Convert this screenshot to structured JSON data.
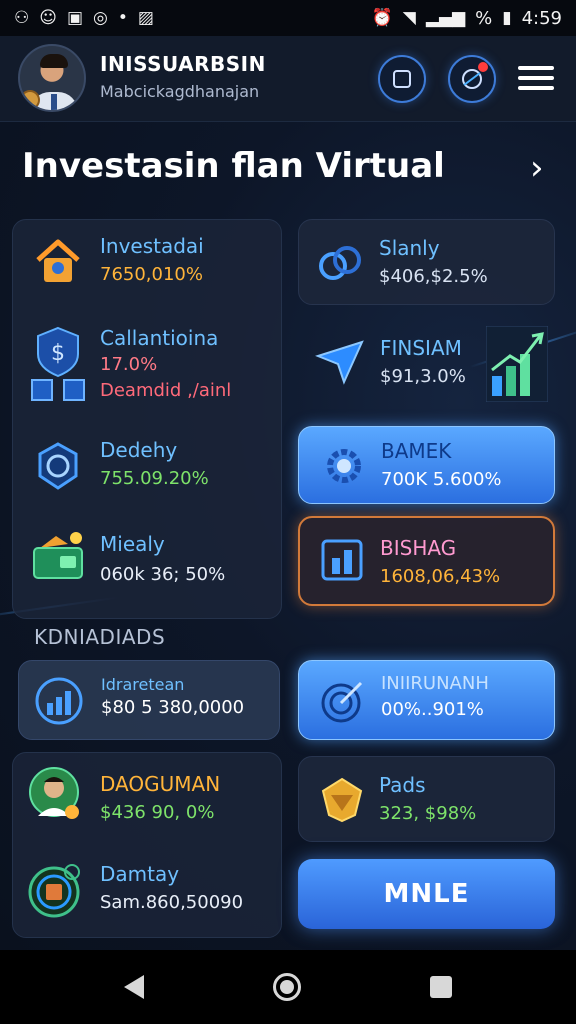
{
  "statusbar": {
    "left_icons": [
      "link-icon",
      "discord-icon",
      "message-icon",
      "shazam-icon",
      "dot-icon",
      "photo-icon"
    ],
    "battery_text": "%",
    "time": "4:59"
  },
  "header": {
    "title": "INISSUARBSIN",
    "subtitle": "Mabcickagdhanajan"
  },
  "section": {
    "title": "Investasin flan Virtual",
    "chevron": "›"
  },
  "left_items": [
    {
      "title": "Investadai",
      "value": "7650,010%",
      "value_color": "#ffb43a",
      "icon": "house-icon"
    },
    {
      "title": "Callantioina",
      "value": "17.0%",
      "value_color": "#ff7a86",
      "sub": "Deamdid ,/ainl",
      "icon": "shield-dollar-icon"
    },
    {
      "title": "Dedehy",
      "value": "755.09.20%",
      "value_color": "#7ee36a",
      "icon": "globe-badge-icon"
    },
    {
      "title": "Miealy",
      "value": "060k 36; 50%",
      "value_color": "#e8eef8",
      "icon": "wallet-icon"
    }
  ],
  "right_items": [
    {
      "title": "Slanly",
      "value": "$406,$2.5%",
      "icon": "link-rings-icon"
    },
    {
      "title": "FINSIAM",
      "value": "$91,3.0%",
      "icon": "paper-plane-icon"
    },
    {
      "title": "BAMEK",
      "value": "700K 5.600%",
      "icon": "gear-icon"
    },
    {
      "title": "BISHAG",
      "value": "1608,06,43%",
      "icon": "chart-box-icon"
    }
  ],
  "kn_label": "KDNIADIADS",
  "bottom_left": [
    {
      "title": "Idraretean",
      "value": "$80 5 380,0000",
      "icon": "bar-chart-circle-icon"
    },
    {
      "title": "DAOGUMAN",
      "value": "$436 90, 0%",
      "icon": "avatar-icon"
    },
    {
      "title": "Damtay",
      "value": "Sam.860,50090",
      "icon": "app-circle-icon"
    }
  ],
  "bottom_right": [
    {
      "title": "INIIRUNANH",
      "value": "00%..901%",
      "icon": "target-arrow-icon"
    },
    {
      "title": "Pads",
      "value": "323, $98%",
      "icon": "gold-gem-icon"
    }
  ],
  "cta": {
    "label": "MNLE"
  },
  "colors": {
    "accent": "#3d7bd8",
    "title_blue": "#6fc0ff",
    "gold": "#ffb43a",
    "green": "#7ee36a",
    "red": "#ff7a86",
    "orange_border": "#d27a3a"
  }
}
